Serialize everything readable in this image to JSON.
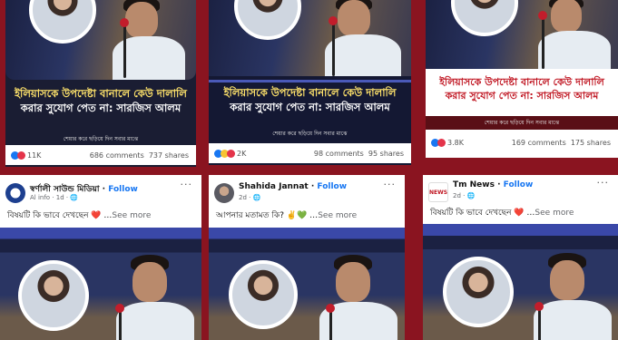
{
  "top_cards": [
    {
      "headline_l1": "ইলিয়াসকে উপদেষ্টা বানালে কেউ দালালি",
      "headline_l2": "করার সুযোগ পেত না: সারজিস আলম",
      "tagline": "শেয়ার করে ছড়িয়ে দিন সবার মাঝে",
      "reaction_count": "11K",
      "comments": "686 comments",
      "shares": "737 shares"
    },
    {
      "headline_l1": "ইলিয়াসকে উপদেষ্টা বানালে কেউ দালালি",
      "headline_l2": "করার সুযোগ পেত না: সারজিস আলম",
      "tagline": "শেয়ার করে ছড়িয়ে দিন সবার মাঝে",
      "reaction_count": "2K",
      "comments": "98 comments",
      "shares": "95 shares"
    },
    {
      "headline_l1": "ইলিয়াসকে উপদেষ্টা বানালে কেউ দালালি",
      "headline_l2": "করার সুযোগ পেত না: সারজিস আলম",
      "tagline": "শেয়ার করে ছড়িয়ে দিন সবার মাঝে",
      "reaction_count": "3.8K",
      "comments": "169 comments",
      "shares": "175 shares"
    }
  ],
  "bottom_posts": [
    {
      "page_name": "স্বর্ণালী সাউন্ড মিডিয়া",
      "follow": "Follow",
      "meta": "Al info · 1d · ",
      "caption": "বিষয়টি কি ভাবে দেখছেন ",
      "caption_emoji": "❤️",
      "see_more": "See more"
    },
    {
      "page_name": "Shahida Jannat",
      "follow": "Follow",
      "meta": "2d · ",
      "caption": "আপনার মতামত কি? ",
      "caption_emoji": "✌️💚",
      "see_more": "See more"
    },
    {
      "page_name": "Tm News",
      "follow": "Follow",
      "meta": "2d · ",
      "caption": "বিষয়টি কি ভাবে দেখছেন ",
      "caption_emoji": "❤️",
      "see_more": "See more"
    }
  ],
  "logo_text": "NEWS",
  "more_dots": "···",
  "colors": {
    "background": "#8a1420",
    "headline_yellow": "#ffe36b",
    "link_blue": "#1877f2"
  }
}
